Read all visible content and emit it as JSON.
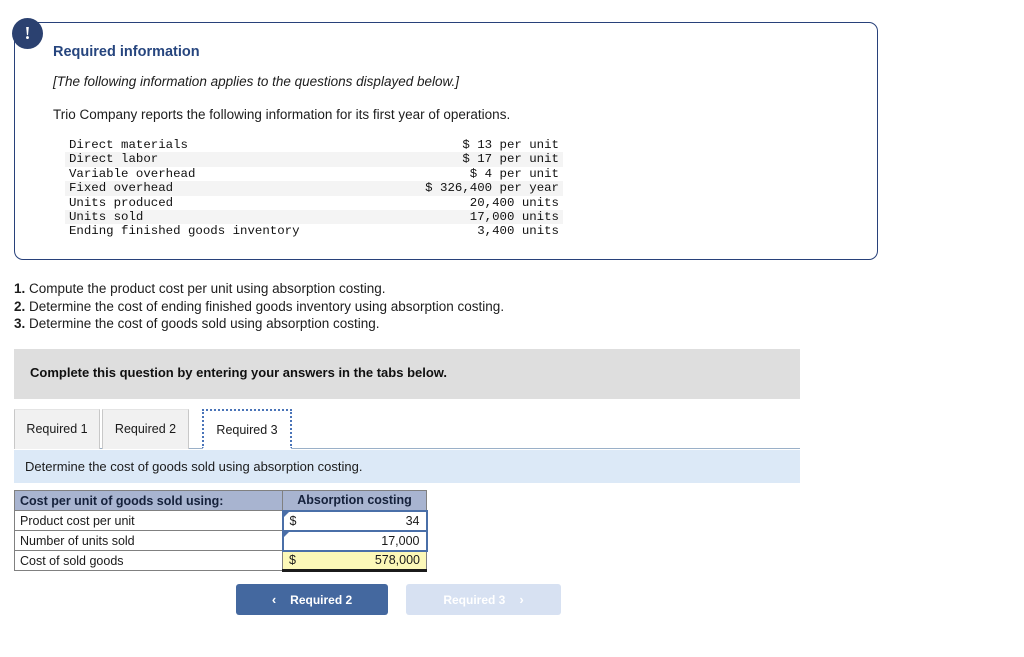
{
  "alert": {
    "icon": "exclamation-icon",
    "glyph": "!"
  },
  "panel": {
    "title": "Required information",
    "italic_note": "[The following information applies to the questions displayed below.]",
    "lead": "Trio Company reports the following information for its first year of operations.",
    "facts": [
      {
        "label": "Direct materials",
        "value": "$ 13 per unit"
      },
      {
        "label": "Direct labor",
        "value": "$ 17 per unit"
      },
      {
        "label": "Variable overhead",
        "value": "$ 4 per unit"
      },
      {
        "label": "Fixed overhead",
        "value": "$ 326,400 per year"
      },
      {
        "label": "Units produced",
        "value": "20,400 units"
      },
      {
        "label": "Units sold",
        "value": "17,000 units"
      },
      {
        "label": "Ending finished goods inventory",
        "value": "3,400 units"
      }
    ]
  },
  "requirements": [
    {
      "num": "1.",
      "text": "Compute the product cost per unit using absorption costing."
    },
    {
      "num": "2.",
      "text": "Determine the cost of ending finished goods inventory using absorption costing."
    },
    {
      "num": "3.",
      "text": "Determine the cost of goods sold using absorption costing."
    }
  ],
  "complete_banner": "Complete this question by entering your answers in the tabs below.",
  "tabs": [
    {
      "label": "Required 1",
      "active": false
    },
    {
      "label": "Required 2",
      "active": false
    },
    {
      "label": "Required 3",
      "active": true
    }
  ],
  "sub_instruction": "Determine the cost of goods sold using absorption costing.",
  "answer_table": {
    "header_label": "Cost per unit of goods sold using:",
    "header_value": "Absorption costing",
    "rows": [
      {
        "label": "Product cost per unit",
        "currency": "$",
        "number": "34",
        "kind": "input"
      },
      {
        "label": "Number of units sold",
        "currency": "",
        "number": "17,000",
        "kind": "input"
      },
      {
        "label": "Cost of sold goods",
        "currency": "$",
        "number": "578,000",
        "kind": "total"
      }
    ]
  },
  "nav": {
    "prev_label": "Required 2",
    "prev_chevron": "‹",
    "next_label": "Required 3",
    "next_chevron": "›"
  },
  "colors": {
    "panel_border": "#28417a",
    "badge": "#2b4170",
    "title": "#26457e",
    "banner_grey": "#dedede",
    "banner_blue": "#dce9f7",
    "table_header": "#a8b4d0",
    "total_yellow": "#fcf8b8",
    "input_border": "#4a6fa8",
    "btn_active": "#44689f",
    "btn_disabled": "#d7e1f2"
  }
}
